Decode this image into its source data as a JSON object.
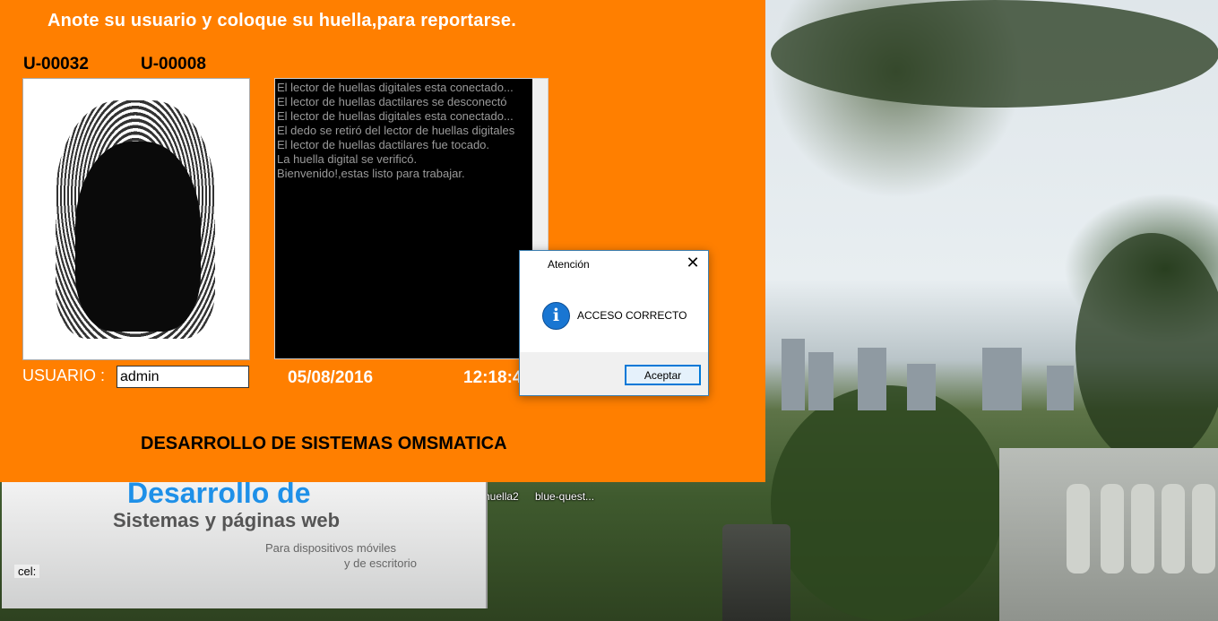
{
  "main_window": {
    "instruction": "Anote su usuario y coloque su huella,para reportarse.",
    "user_codes": [
      "U-00032",
      "U-00008"
    ],
    "log_lines": [
      "El lector de huellas digitales esta conectado...",
      "El lector de huellas dactilares se desconectó",
      "El lector de huellas digitales esta conectado...",
      "El dedo se retiró del lector de huellas digitales",
      "El lector de huellas dactilares fue tocado.",
      "La huella digital se verificó.",
      "Bienvenido!,estas listo para trabajar."
    ],
    "usuario_label": "USUARIO :",
    "usuario_value": "admin",
    "date": "05/08/2016",
    "time": "12:18:4",
    "footer": "DESARROLLO DE SISTEMAS  OMSMATICA",
    "background_color": "#ff7f00"
  },
  "dialog": {
    "title": "Atención",
    "close_glyph": "✕",
    "icon_glyph": "i",
    "message": "ACCESO CORRECTO",
    "ok_label": "Aceptar"
  },
  "promo": {
    "title1": "Desarrollo de",
    "title2": "Sistemas y páginas web",
    "sub1": "Para dispositivos móviles",
    "sub2": "y de escritorio",
    "cel_label": "cel:"
  },
  "desktop_icons": [
    "huella2",
    "blue-quest..."
  ]
}
